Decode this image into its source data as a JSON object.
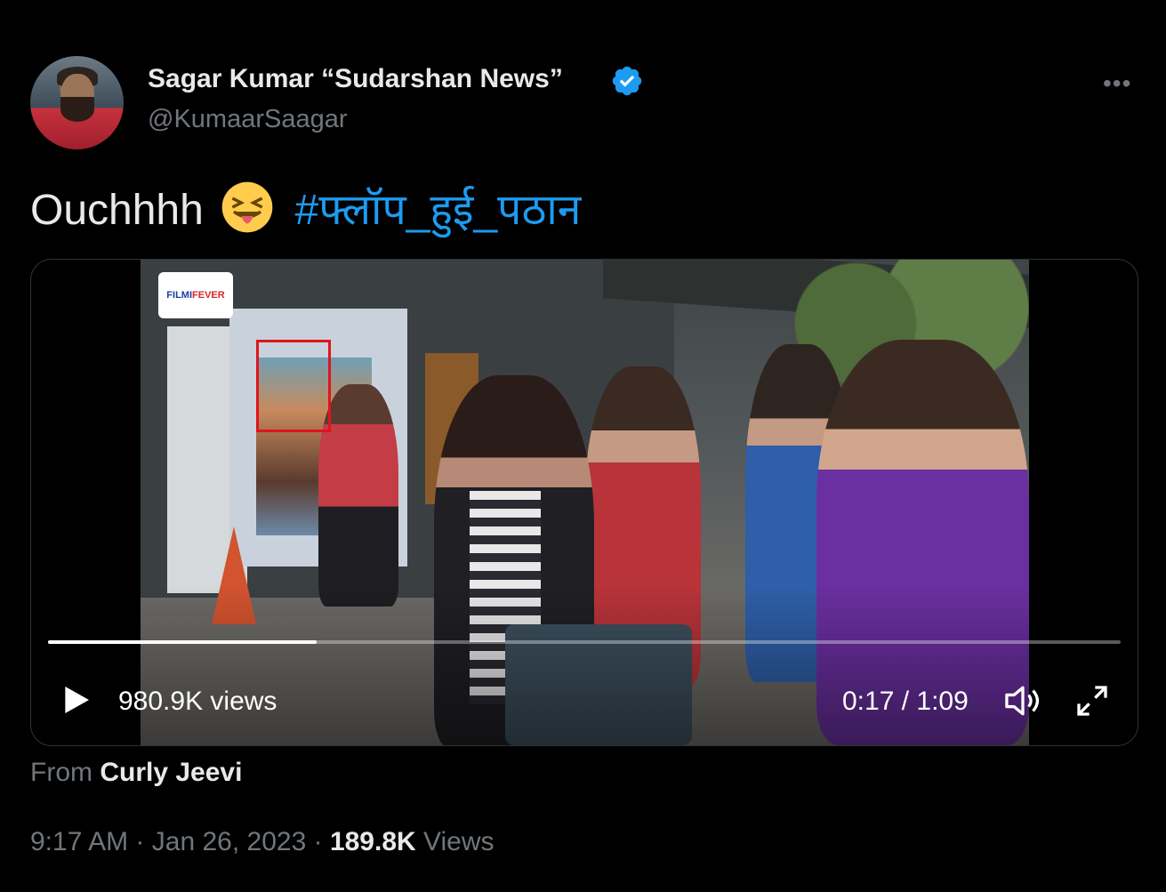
{
  "author": {
    "name": "Sagar Kumar “Sudarshan News”",
    "handle": "@KumaarSaagar",
    "verified": true
  },
  "menu_icon": "more-horizontal-icon",
  "tweet": {
    "text": "Ouchhhh",
    "emoji": "😝",
    "hashtag": "#फ्लॉप_हुई_पठान"
  },
  "video": {
    "logo_text_1": "FILMI",
    "logo_text_2": "FEVER",
    "views": "980.9K views",
    "time": "0:17 / 1:09",
    "progress": 0.25
  },
  "source": {
    "prefix": "From",
    "name": "Curly Jeevi"
  },
  "meta": {
    "time": "9:17 AM",
    "sep": "·",
    "date": "Jan 26, 2023",
    "views_count": "189.8K",
    "views_label": "Views"
  },
  "colors": {
    "background": "#000000",
    "text": "#e7e9ea",
    "secondary": "#71767b",
    "link": "#1d9bf0",
    "highlight": "#e0141c"
  }
}
